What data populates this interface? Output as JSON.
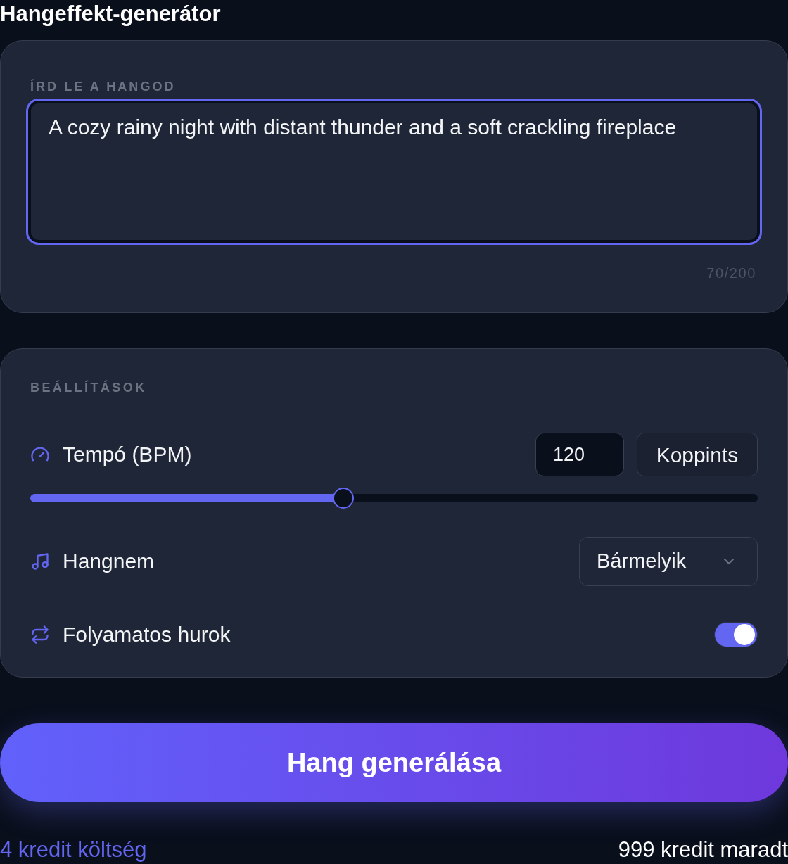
{
  "title": "Hangeffekt-generátor",
  "description": {
    "label": "ÍRD LE A HANGOD",
    "value": "A cozy rainy night with distant thunder and a soft crackling fireplace",
    "focused": true,
    "counter": "70/200"
  },
  "settings": {
    "heading": "BEÁLLÍTÁSOK",
    "rows": [
      {
        "kind": "tempo",
        "label": "Tempó (BPM)",
        "value": "120",
        "button": "Koppints",
        "level": 0.43
      },
      {
        "kind": "select",
        "label": "Hangnem",
        "value": "Bármelyik"
      },
      {
        "kind": "toggle",
        "label": "Folyamatos hurok",
        "on": true
      }
    ]
  },
  "generate_button": {
    "label": "Hang generálása"
  },
  "footer": {
    "cost": "4 kredit költség",
    "remaining": "999 kredit maradt"
  }
}
